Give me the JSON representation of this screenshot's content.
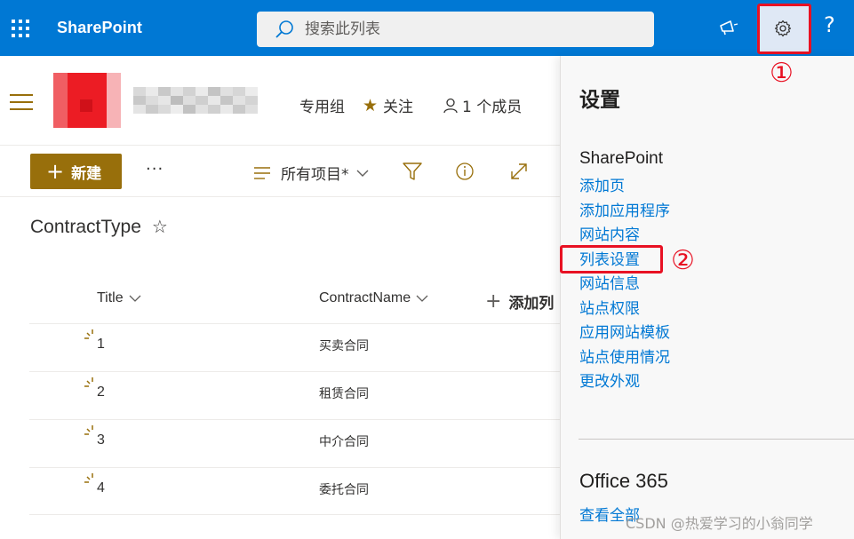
{
  "suitebar": {
    "app_name": "SharePoint",
    "search_placeholder": "搜索此列表",
    "help_label": "?",
    "accent": "#0078d4"
  },
  "site": {
    "group_label": "专用组",
    "follow_label": "关注",
    "members_label": "1 个成员"
  },
  "command_bar": {
    "new_label": "新建",
    "more_label": "···",
    "view_label": "所有项目*"
  },
  "list": {
    "title": "ContractType",
    "columns": [
      "Title",
      "ContractName"
    ],
    "add_column_label": "添加列",
    "rows": [
      {
        "title": "1",
        "name": "买卖合同"
      },
      {
        "title": "2",
        "name": "租赁合同"
      },
      {
        "title": "3",
        "name": "中介合同"
      },
      {
        "title": "4",
        "name": "委托合同"
      }
    ],
    "brand_color": "#986f0b"
  },
  "settings_panel": {
    "title": "设置",
    "section": "SharePoint",
    "links": [
      "添加页",
      "添加应用程序",
      "网站内容",
      "列表设置",
      "网站信息",
      "站点权限",
      "应用网站模板",
      "站点使用情况",
      "更改外观"
    ],
    "office_title": "Office 365",
    "view_all": "查看全部"
  },
  "annotations": {
    "mark_1": "①",
    "mark_2": "②",
    "highlight_color": "#e81123"
  },
  "watermark": "CSDN @热爱学习的小翁同学"
}
